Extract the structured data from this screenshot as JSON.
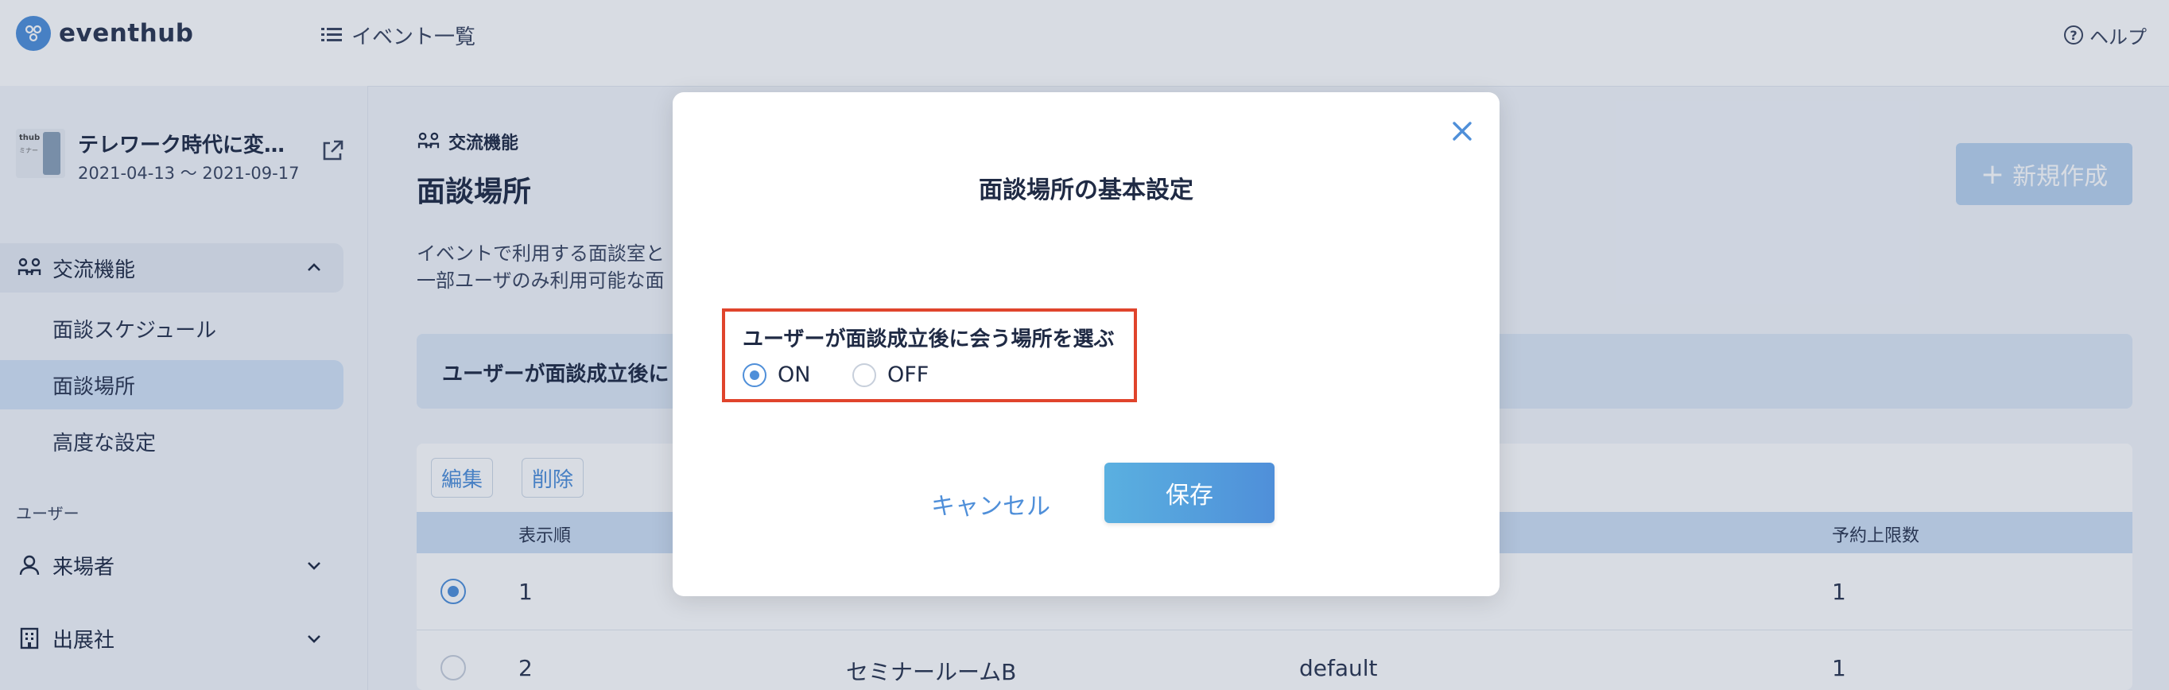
{
  "header": {
    "brand": "eventhub",
    "nav_events": "イベント一覧",
    "help": "ヘルプ"
  },
  "sidebar": {
    "event": {
      "title": "テレワーク時代に変…",
      "date_range": "2021-04-13 〜 2021-09-17",
      "thumb_text_1": "thub",
      "thumb_text_2": "ミナー"
    },
    "groups": [
      {
        "label": "交流機能",
        "expanded": true,
        "items": [
          {
            "label": "面談スケジュール",
            "selected": false
          },
          {
            "label": "面談場所",
            "selected": true
          },
          {
            "label": "高度な設定",
            "selected": false
          }
        ]
      }
    ],
    "section_user": "ユーザー",
    "group_visitors": "来場者",
    "group_exhibitors": "出展社"
  },
  "main": {
    "breadcrumb": "交流機能",
    "title": "面談場所",
    "new_button": "新規作成",
    "description_line1": "イベントで利用する面談室と",
    "description_line2": "一部ユーザのみ利用可能な面",
    "notice": "ユーザーが面談成立後に",
    "toolbar": {
      "edit": "編集",
      "delete": "削除"
    },
    "table": {
      "headers": [
        "表示順",
        "予約上限数"
      ],
      "rows": [
        {
          "order": "1",
          "name": "",
          "type": "",
          "limit": "1",
          "selected": true
        },
        {
          "order": "2",
          "name": "セミナールームB",
          "type": "default",
          "limit": "1",
          "selected": false
        }
      ]
    }
  },
  "modal": {
    "title": "面談場所の基本設定",
    "field_label": "ユーザーが面談成立後に会う場所を選ぶ",
    "options": [
      {
        "label": "ON",
        "checked": true
      },
      {
        "label": "OFF",
        "checked": false
      }
    ],
    "cancel": "キャンセル",
    "save": "保存"
  },
  "colors": {
    "accent": "#4f8fd9",
    "highlight_border": "#e0442c"
  }
}
